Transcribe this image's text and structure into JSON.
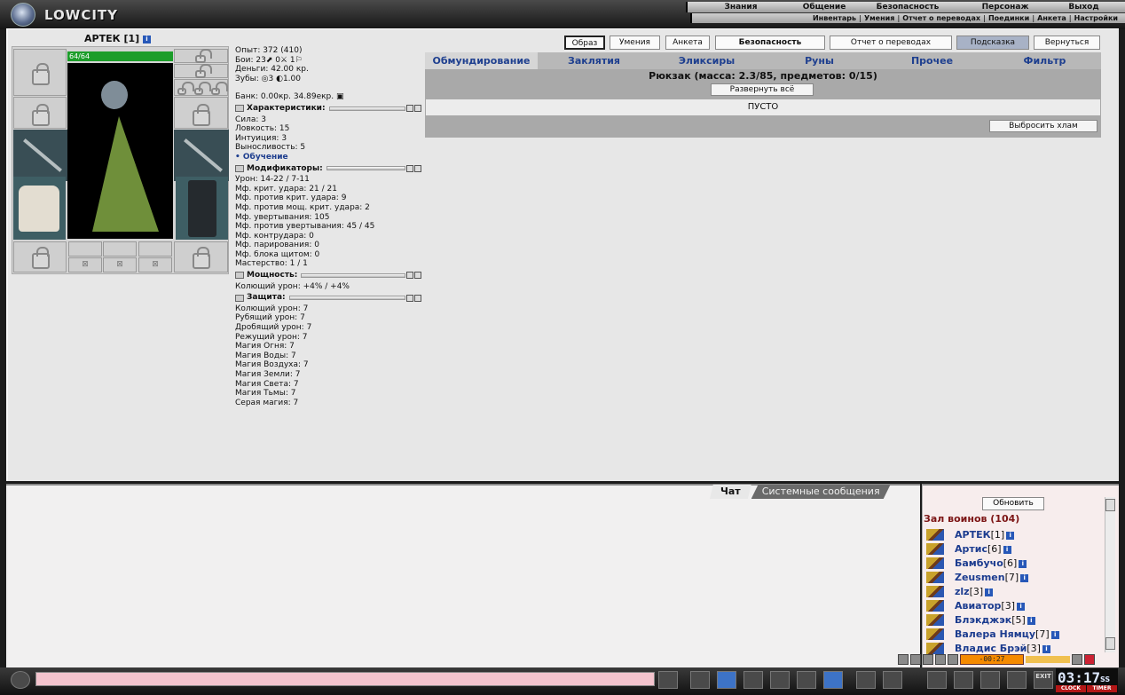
{
  "app": {
    "logo_text": "LOWCITY"
  },
  "menu": {
    "top": [
      "Знания",
      "Общение",
      "Безопасность",
      "Персонаж",
      "Выход"
    ],
    "sub": [
      "Инвентарь",
      "Умения",
      "Отчет о переводах",
      "Поединки",
      "Анкета",
      "Настройки"
    ]
  },
  "character": {
    "name": "АРТЕК",
    "level": "[1]",
    "hp": "64/64",
    "runes": [
      "⊠",
      "⊠",
      "⊠"
    ]
  },
  "stats": {
    "exp": "Опыт: 372 (410)",
    "battles": "Бои: 23⬈ 0⚔ 1⚐",
    "money": "Деньги: 42.00 кр.",
    "teeth": "Зубы: ◎3 ◐1.00",
    "bank": "Банк: 0.00кр. 34.89екр. ▣"
  },
  "sections": {
    "char": "Характеристики:",
    "mods": "Модификаторы:",
    "power": "Мощность:",
    "defense": "Защита:"
  },
  "char_rows": [
    "Сила: 3",
    "Ловкость: 15",
    "Интуиция: 3",
    "Выносливость: 5"
  ],
  "training_link": "• Обучение",
  "mod_rows": [
    "Урон: 14-22 / 7-11",
    "Мф. крит. удара: 21 / 21",
    "Мф. против крит. удара: 9",
    "Мф. против мощ. крит. удара: 2",
    "Мф. увертывания: 105",
    "Мф. против увертывания: 45 / 45",
    "Мф. контрудара: 0",
    "Мф. парирования: 0",
    "Мф. блока щитом: 0",
    "Мастерство: 1 / 1"
  ],
  "power_rows": [
    "Колющий урон: +4% / +4%"
  ],
  "defense_rows": [
    "Колющий урон: 7",
    "Рубящий урон: 7",
    "Дробящий урон: 7",
    "Режущий урон: 7",
    "Магия Огня: 7",
    "Магия Воды: 7",
    "Магия Воздуха: 7",
    "Магия Земли: 7",
    "Магия Света: 7",
    "Магия Тьмы: 7",
    "Серая магия: 7"
  ],
  "top_buttons": [
    "Образ",
    "Умения",
    "Анкета",
    "Безопасность",
    "Отчет о переводах",
    "Подсказка",
    "Вернуться"
  ],
  "inventory": {
    "tabs": [
      "Обмундирование",
      "Заклятия",
      "Эликсиры",
      "Руны",
      "Прочее",
      "Фильтр"
    ],
    "title": "Рюкзак (масса: 2.3/85, предметов: 0/15)",
    "expand": "Развернуть всё",
    "empty": "ПУСТО",
    "discard": "Выбросить хлам"
  },
  "chat": {
    "tabs": [
      "Чат",
      "Системные сообщения"
    ]
  },
  "online": {
    "refresh": "Обновить",
    "room": "Зал воинов (104)",
    "users": [
      {
        "name": "АРТЕК",
        "lvl": "[1]"
      },
      {
        "name": "Артис",
        "lvl": "[6]"
      },
      {
        "name": "Бамбучо",
        "lvl": "[6]"
      },
      {
        "name": "Zeusmen",
        "lvl": "[7]"
      },
      {
        "name": "zlz",
        "lvl": "[3]"
      },
      {
        "name": "Авиатор",
        "lvl": "[3]"
      },
      {
        "name": "Блэкджэк",
        "lvl": "[5]"
      },
      {
        "name": "Валера Нямцу",
        "lvl": "[7]"
      },
      {
        "name": "Владис Брэй",
        "lvl": "[3]"
      }
    ]
  },
  "player": {
    "display": "-00:27"
  },
  "clock": {
    "time": "03:17",
    "sec": "SS",
    "clock_label": "CLOCK",
    "timer_label": "TIMER",
    "exit": "EXIT"
  }
}
